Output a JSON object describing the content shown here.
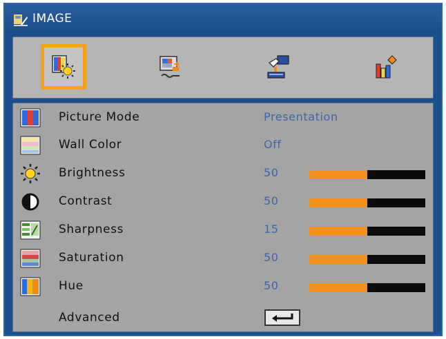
{
  "window": {
    "title": "IMAGE"
  },
  "tabs": [
    {
      "icon": "image-settings-icon",
      "selected": true
    },
    {
      "icon": "display-settings-icon",
      "selected": false
    },
    {
      "icon": "setup-icon",
      "selected": false
    },
    {
      "icon": "options-icon",
      "selected": false
    }
  ],
  "colors": {
    "selection": "#f4a21a",
    "bar_fill": "#f4901e",
    "bar_track": "#0b0b0b",
    "value_text": "#3f63a6"
  },
  "settings": [
    {
      "label": "Picture Mode",
      "value": "Presentation",
      "icon": "picture-mode-icon"
    },
    {
      "label": "Wall Color",
      "value": "Off",
      "icon": "wall-color-icon"
    },
    {
      "label": "Brightness",
      "value": "50",
      "level": 0.5,
      "icon": "brightness-icon"
    },
    {
      "label": "Contrast",
      "value": "50",
      "level": 0.5,
      "icon": "contrast-icon"
    },
    {
      "label": "Sharpness",
      "value": "15",
      "level": 0.5,
      "icon": "sharpness-icon"
    },
    {
      "label": "Saturation",
      "value": "50",
      "level": 0.5,
      "icon": "saturation-icon"
    },
    {
      "label": "Hue",
      "value": "50",
      "level": 0.5,
      "icon": "hue-icon"
    },
    {
      "label": "Advanced",
      "icon": "enter-icon"
    }
  ]
}
